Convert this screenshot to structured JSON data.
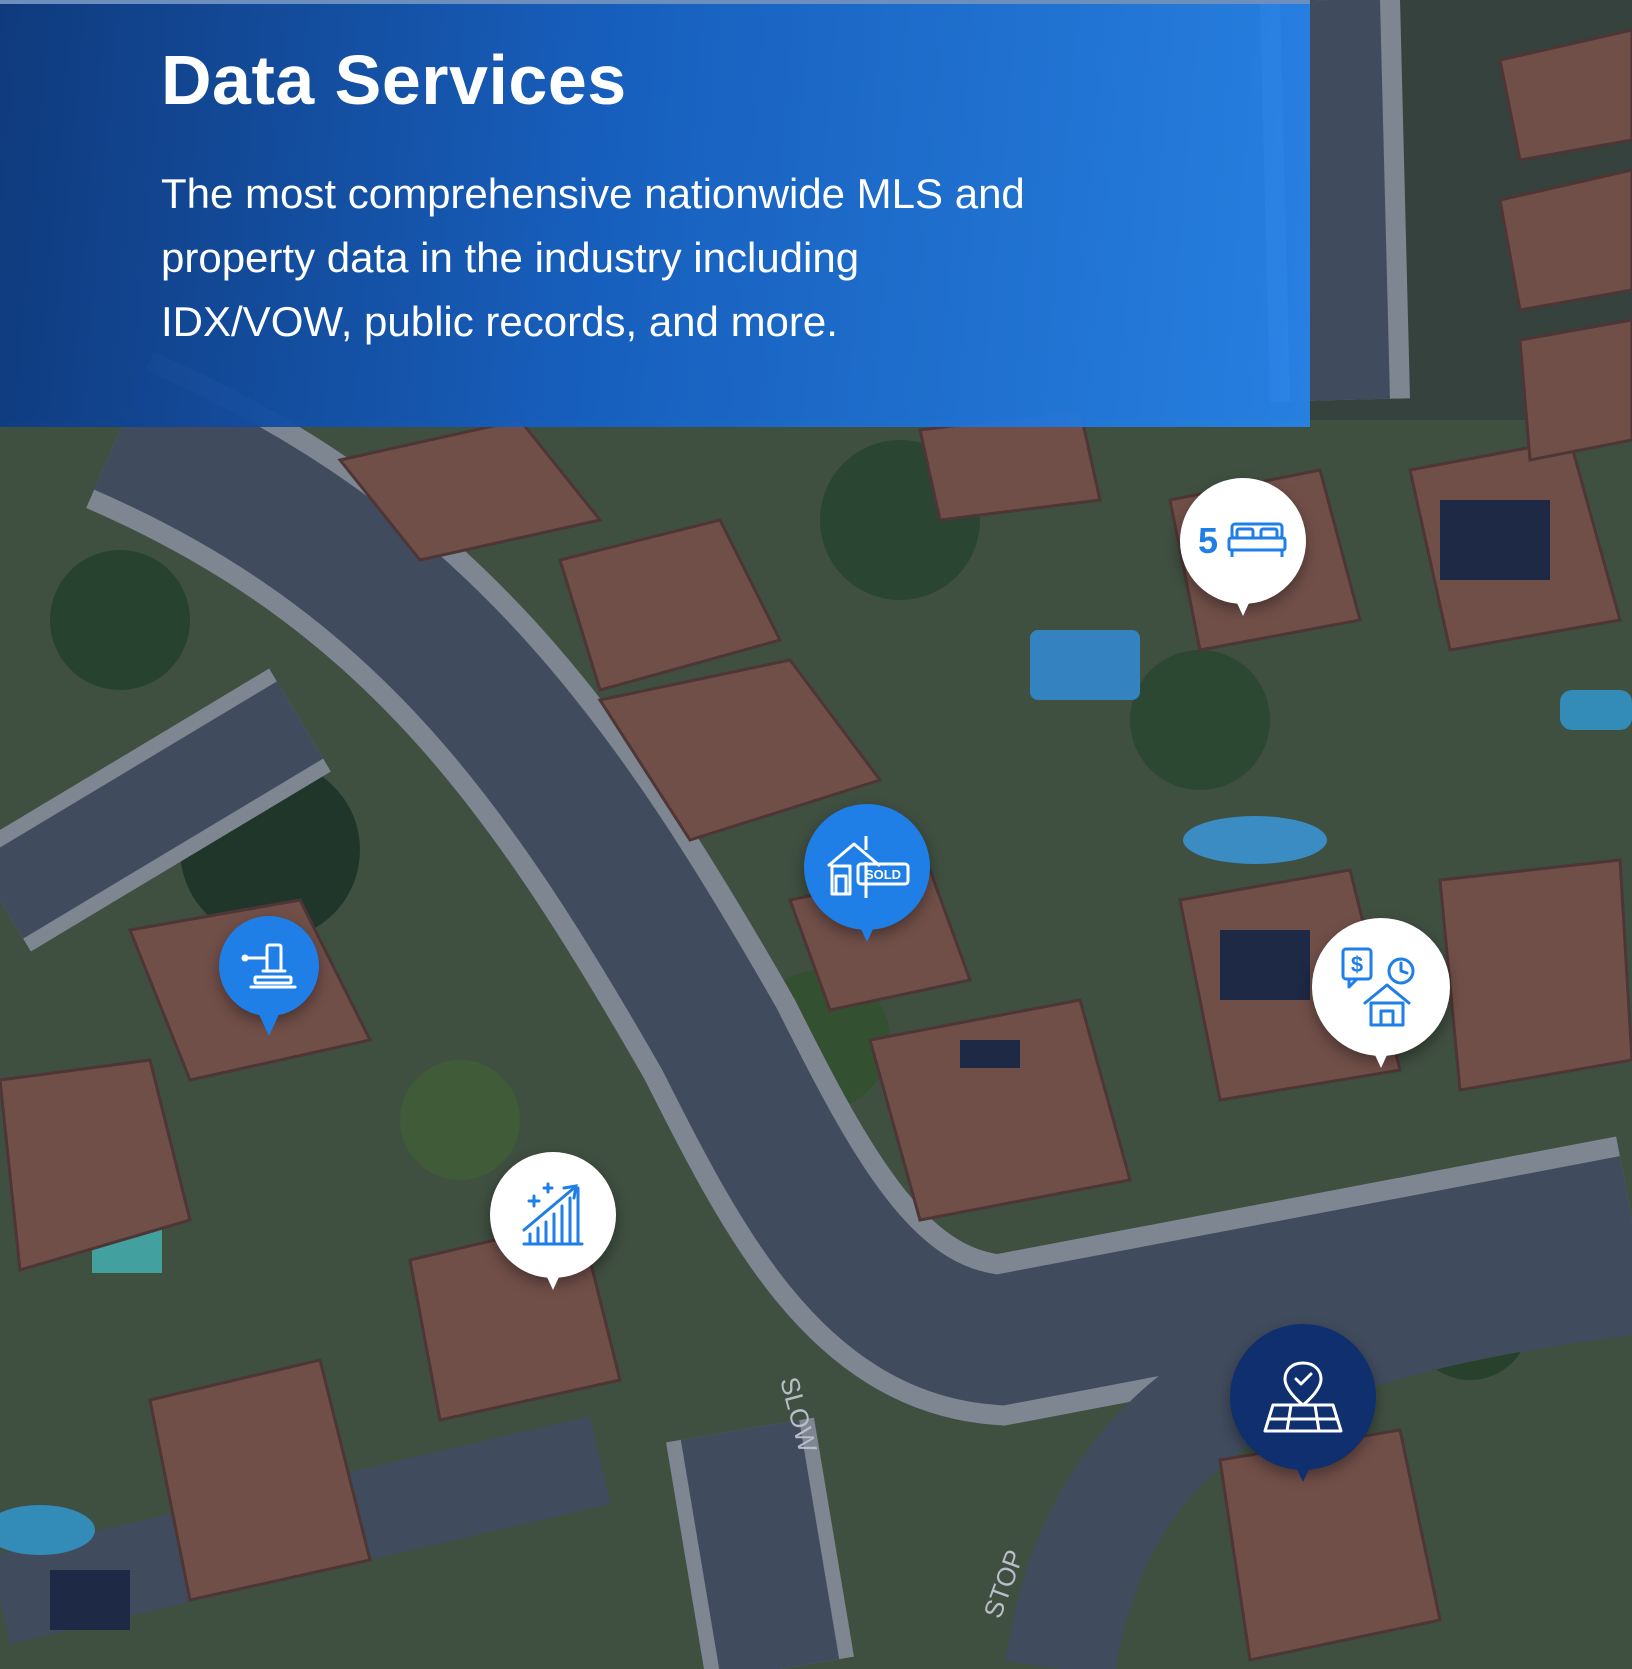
{
  "hero": {
    "title": "Data Services",
    "description": "The most comprehensive nationwide MLS and property data in the industry including IDX/VOW, public records, and more."
  },
  "pins": {
    "bedrooms": {
      "count": "5",
      "icon": "bed-icon"
    },
    "sold": {
      "label": "SOLD",
      "icon": "sold-sign-house-icon"
    },
    "auction": {
      "icon": "gavel-icon"
    },
    "valuation": {
      "icon": "price-history-house-icon"
    },
    "trends": {
      "icon": "growth-chart-icon"
    },
    "location": {
      "icon": "map-pin-check-icon"
    }
  },
  "street_marks": [
    "SLOW",
    "STOP"
  ],
  "colors": {
    "hero_start": "#0e3a80",
    "hero_end": "#2684ec",
    "pin_blue": "#1f7fe6",
    "pin_navy": "#0f2f6e",
    "pin_white": "#ffffff"
  }
}
